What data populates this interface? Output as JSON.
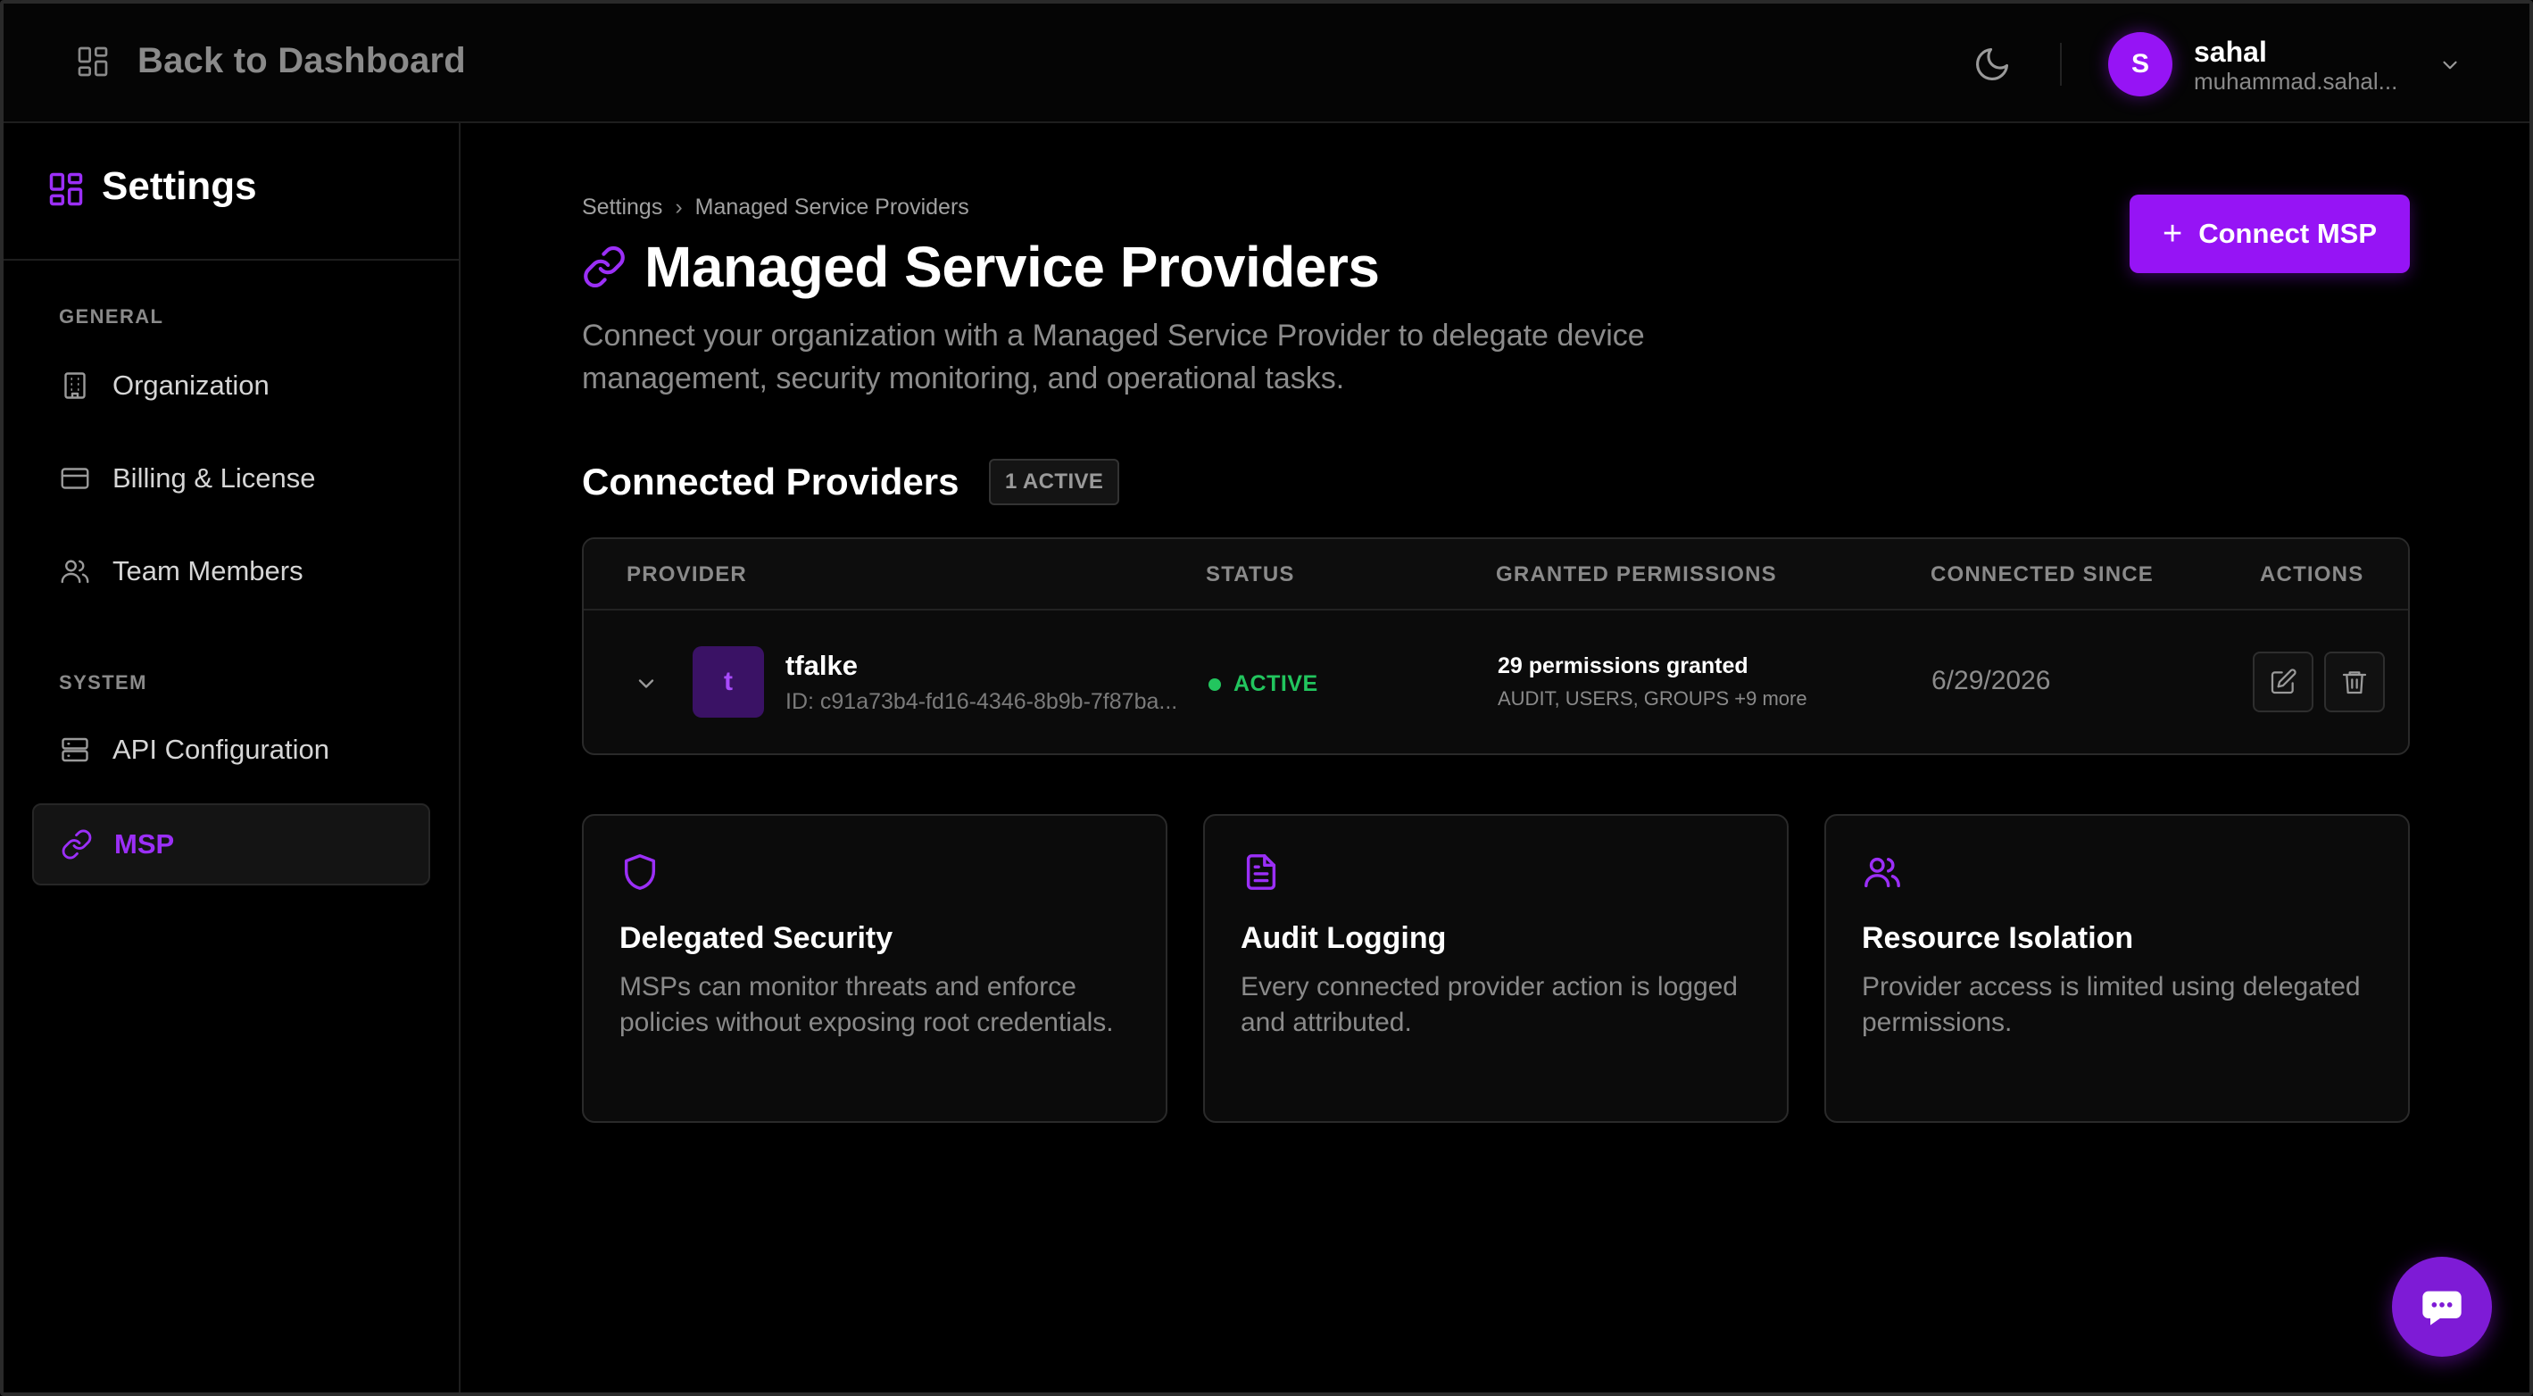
{
  "topbar": {
    "back_label": "Back to Dashboard",
    "user_initial": "S",
    "user_name": "sahal",
    "user_email": "muhammad.sahal..."
  },
  "sidebar": {
    "title": "Settings",
    "general_label": "GENERAL",
    "system_label": "SYSTEM",
    "items": [
      {
        "label": "Organization",
        "icon": "building-icon"
      },
      {
        "label": "Billing & License",
        "icon": "credit-card-icon"
      },
      {
        "label": "Team Members",
        "icon": "users-icon"
      },
      {
        "label": "API Configuration",
        "icon": "server-icon"
      },
      {
        "label": "MSP",
        "icon": "link-icon",
        "active": true
      }
    ]
  },
  "main": {
    "breadcrumb": {
      "root": "Settings",
      "separator": "›",
      "current": "Managed Service Providers"
    },
    "title": "Managed Service Providers",
    "description": "Connect your organization with a Managed Service Provider to delegate device management, security monitoring, and operational tasks.",
    "connect_button": "Connect MSP",
    "connected_title": "Connected Providers",
    "active_badge": "1 ACTIVE",
    "table": {
      "headers": [
        "PROVIDER",
        "STATUS",
        "GRANTED PERMISSIONS",
        "CONNECTED SINCE",
        "ACTIONS"
      ],
      "rows": [
        {
          "initial": "t",
          "name": "tfalke",
          "id": "ID: c91a73b4-fd16-4346-8b9b-7f87ba...",
          "status": "ACTIVE",
          "permissions": "29 permissions granted",
          "permissions_detail": "AUDIT, USERS, GROUPS +9 more",
          "since": "6/29/2026"
        }
      ]
    },
    "cards": [
      {
        "icon": "shield-icon",
        "title": "Delegated Security",
        "text": "MSPs can monitor threats and enforce policies without exposing root credentials."
      },
      {
        "icon": "document-icon",
        "title": "Audit Logging",
        "text": "Every connected provider action is logged and attributed."
      },
      {
        "icon": "users-icon",
        "title": "Resource Isolation",
        "text": "Provider access is limited using delegated permissions."
      }
    ]
  },
  "colors": {
    "accent": "#9614f5",
    "background": "#000000",
    "status_active": "#22c55e",
    "muted_text": "#8a8a8a"
  }
}
